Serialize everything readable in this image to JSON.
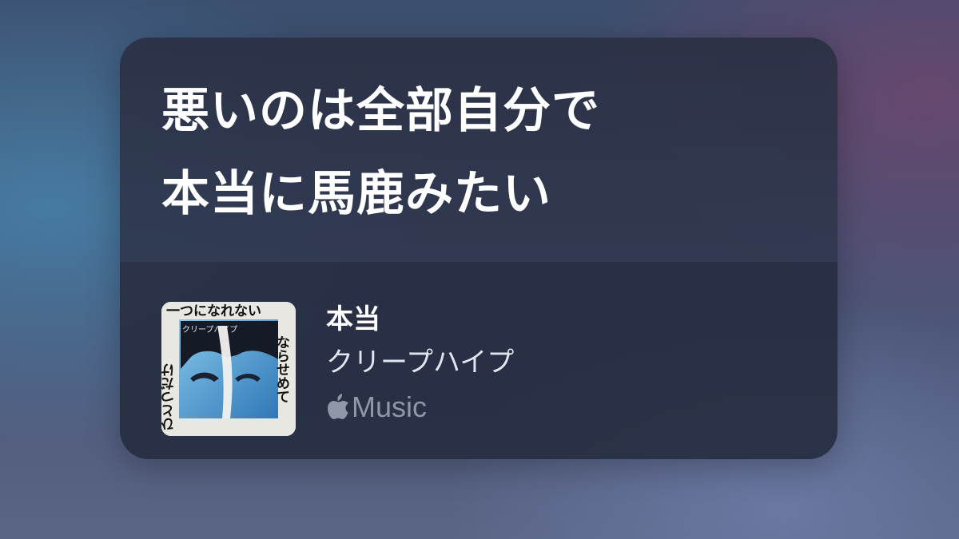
{
  "lyrics": {
    "lines": [
      "悪いのは全部自分で",
      "本当に馬鹿みたい"
    ]
  },
  "track": {
    "title": "本当",
    "artist": "クリープハイプ",
    "artwork": {
      "icon": "album-artwork",
      "text": {
        "top": "一つになれない",
        "right": "ならせめて",
        "left": "ひとつだけ",
        "band": "クリープハイプ"
      }
    },
    "service": {
      "icon": "apple-logo-icon",
      "name": "Music"
    }
  },
  "colors": {
    "card_background": "#2c3144",
    "text_primary": "#ffffff",
    "text_secondary": "#e3e6ee",
    "service_text": "#8f96a8"
  }
}
